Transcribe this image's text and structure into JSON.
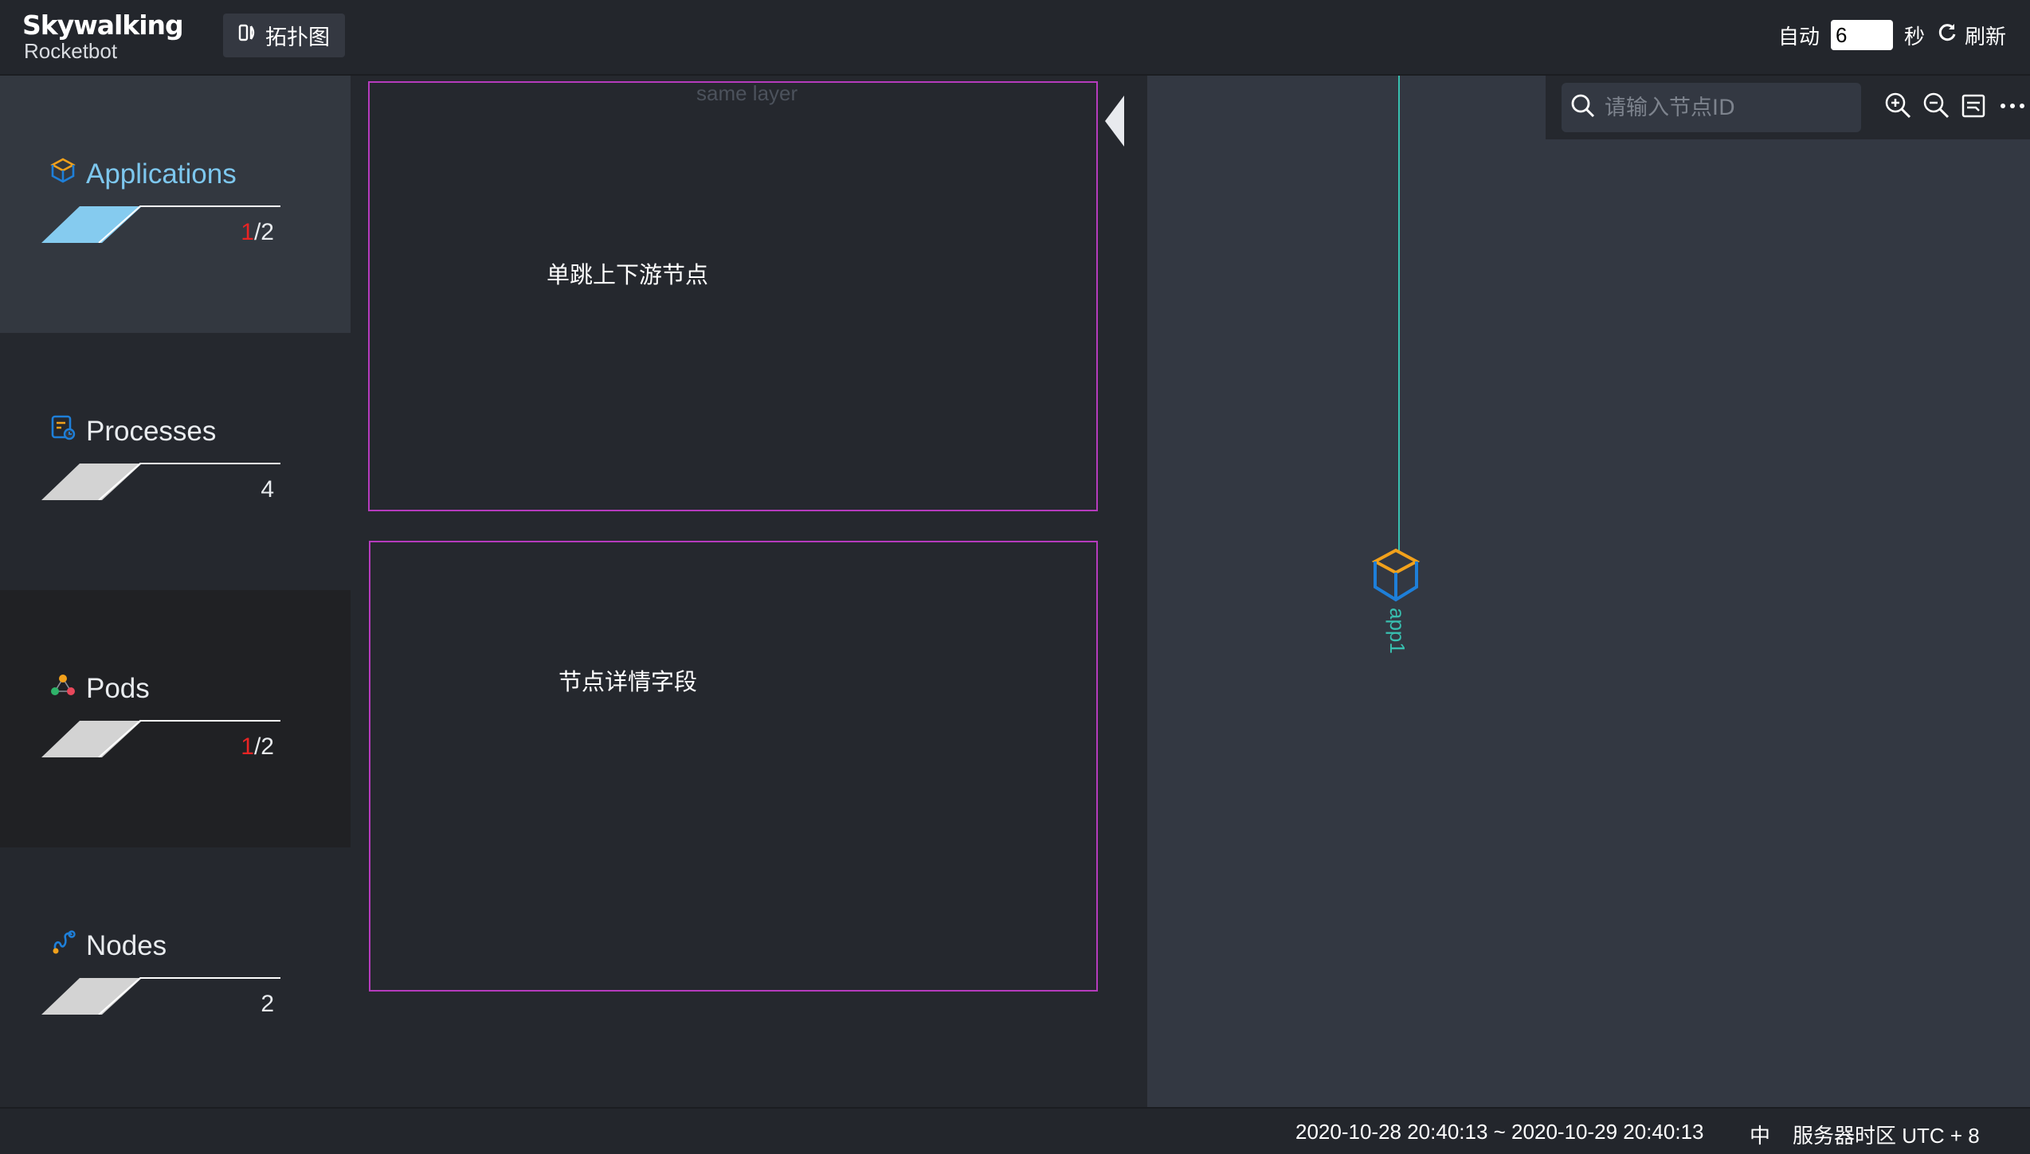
{
  "header": {
    "logo_main": "Skywalking",
    "logo_sub": "Rocketbot",
    "topology_button": "拓扑图",
    "auto_label": "自动",
    "interval_value": "6",
    "seconds_label": "秒",
    "refresh_label": "刷新"
  },
  "sidebar": {
    "items": [
      {
        "label": "Applications",
        "count_highlight": "1",
        "count_total": "/2"
      },
      {
        "label": "Processes",
        "count_highlight": "",
        "count_total": "4"
      },
      {
        "label": "Pods",
        "count_highlight": "1",
        "count_total": "/2"
      },
      {
        "label": "Nodes",
        "count_highlight": "",
        "count_total": "2"
      }
    ]
  },
  "panel": {
    "same_layer": "same layer",
    "upstream_label": "单跳上下游节点",
    "detail_label": "节点详情字段"
  },
  "canvas": {
    "search_placeholder": "请输入节点ID",
    "node_name": "app1"
  },
  "footer": {
    "time_range": "2020-10-28 20:40:13 ~ 2020-10-29 20:40:13",
    "language": "中",
    "timezone": "服务器时区 UTC + 8"
  },
  "colors": {
    "accent": "#7dc7ee",
    "highlight_count": "#e82424",
    "annotation_border": "#b63bbd",
    "edge": "#38c0b0",
    "node_top": "#f2a11b",
    "node_side": "#1e7fd9"
  },
  "icons": [
    "topology-icon",
    "refresh-icon",
    "application-cube-icon",
    "process-icon",
    "pod-icon",
    "node-link-icon",
    "search-icon",
    "zoom-in-icon",
    "zoom-out-icon",
    "fit-view-icon",
    "more-icon",
    "collapse-arrow-icon"
  ]
}
